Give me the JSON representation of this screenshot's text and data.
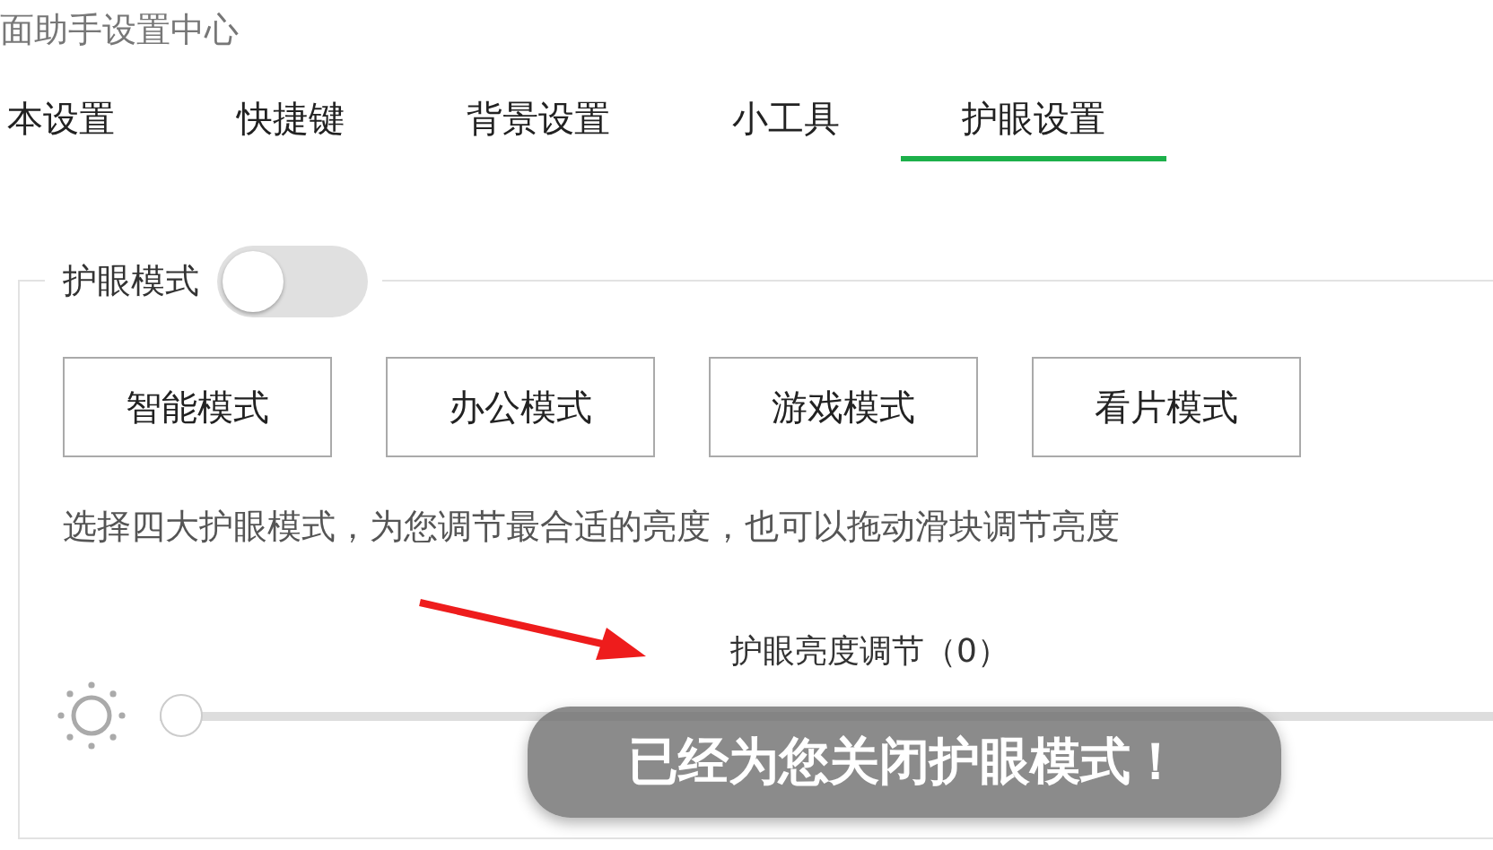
{
  "window": {
    "title": "面助手设置中心"
  },
  "tabs": [
    {
      "label": "本设置",
      "selected": false
    },
    {
      "label": "快捷键",
      "selected": false
    },
    {
      "label": "背景设置",
      "selected": false
    },
    {
      "label": "小工具",
      "selected": false
    },
    {
      "label": "护眼设置",
      "selected": true
    }
  ],
  "eye_mode": {
    "label": "护眼模式",
    "on": false
  },
  "modes": [
    "智能模式",
    "办公模式",
    "游戏模式",
    "看片模式"
  ],
  "description": "选择四大护眼模式，为您调节最合适的亮度，也可以拖动滑块调节亮度",
  "brightness": {
    "label": "护眼亮度调节（0）",
    "level": 0
  },
  "toast": "已经为您关闭护眼模式！"
}
